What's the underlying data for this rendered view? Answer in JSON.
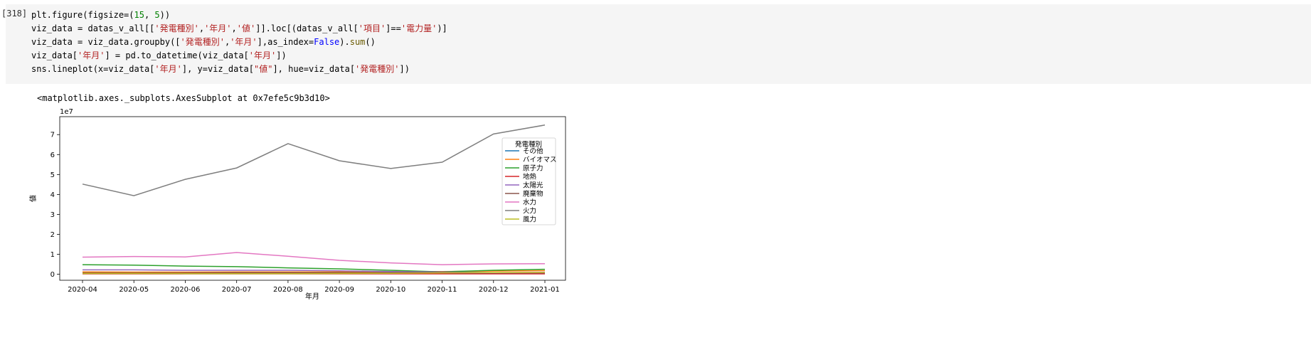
{
  "cell": {
    "prompt": "[318]",
    "output_repr": "<matplotlib.axes._subplots.AxesSubplot at 0x7efe5c9b3d10>"
  },
  "colors": {
    "cell_bg": "#f5f5f5",
    "string": "#b22222",
    "number": "#008000",
    "keyword": "#0000ff"
  },
  "chart_data": {
    "type": "line",
    "x": [
      "2020-04",
      "2020-05",
      "2020-06",
      "2020-07",
      "2020-08",
      "2020-09",
      "2020-10",
      "2020-11",
      "2020-12",
      "2021-01"
    ],
    "xlabel": "年月",
    "ylabel": "値",
    "offset_label": "1e7",
    "y_ticks": [
      0,
      1,
      2,
      3,
      4,
      5,
      6,
      7
    ],
    "ylim": [
      -0.3,
      7.9
    ],
    "y_scale": 10000000,
    "legend_title": "発電種別",
    "legend_position": "right",
    "grid": false,
    "series": [
      {
        "name": "その他",
        "color": "#1f77b4",
        "values": [
          0.05,
          0.05,
          0.05,
          0.05,
          0.05,
          0.05,
          0.05,
          0.05,
          0.05,
          0.05
        ]
      },
      {
        "name": "バイオマス",
        "color": "#ff7f0e",
        "values": [
          0.12,
          0.11,
          0.11,
          0.12,
          0.12,
          0.12,
          0.13,
          0.14,
          0.16,
          0.18
        ]
      },
      {
        "name": "原子力",
        "color": "#2ca02c",
        "values": [
          0.48,
          0.46,
          0.41,
          0.38,
          0.32,
          0.27,
          0.2,
          0.12,
          0.2,
          0.25
        ]
      },
      {
        "name": "地熱",
        "color": "#d62728",
        "values": [
          0.02,
          0.02,
          0.02,
          0.02,
          0.02,
          0.02,
          0.02,
          0.02,
          0.02,
          0.02
        ]
      },
      {
        "name": "太陽光",
        "color": "#9467bd",
        "values": [
          0.22,
          0.22,
          0.2,
          0.2,
          0.2,
          0.17,
          0.14,
          0.11,
          0.08,
          0.1
        ]
      },
      {
        "name": "廃棄物",
        "color": "#8c564b",
        "values": [
          0.07,
          0.07,
          0.07,
          0.08,
          0.08,
          0.08,
          0.08,
          0.08,
          0.08,
          0.08
        ]
      },
      {
        "name": "水力",
        "color": "#e377c2",
        "values": [
          0.86,
          0.89,
          0.87,
          1.09,
          0.9,
          0.7,
          0.57,
          0.48,
          0.52,
          0.53
        ]
      },
      {
        "name": "火力",
        "color": "#7f7f7f",
        "values": [
          4.52,
          3.94,
          4.76,
          5.33,
          6.55,
          5.69,
          5.3,
          5.62,
          7.03,
          7.48
        ]
      },
      {
        "name": "風力",
        "color": "#bcbd22",
        "values": [
          0.04,
          0.04,
          0.03,
          0.03,
          0.03,
          0.04,
          0.05,
          0.07,
          0.08,
          0.09
        ]
      }
    ]
  }
}
